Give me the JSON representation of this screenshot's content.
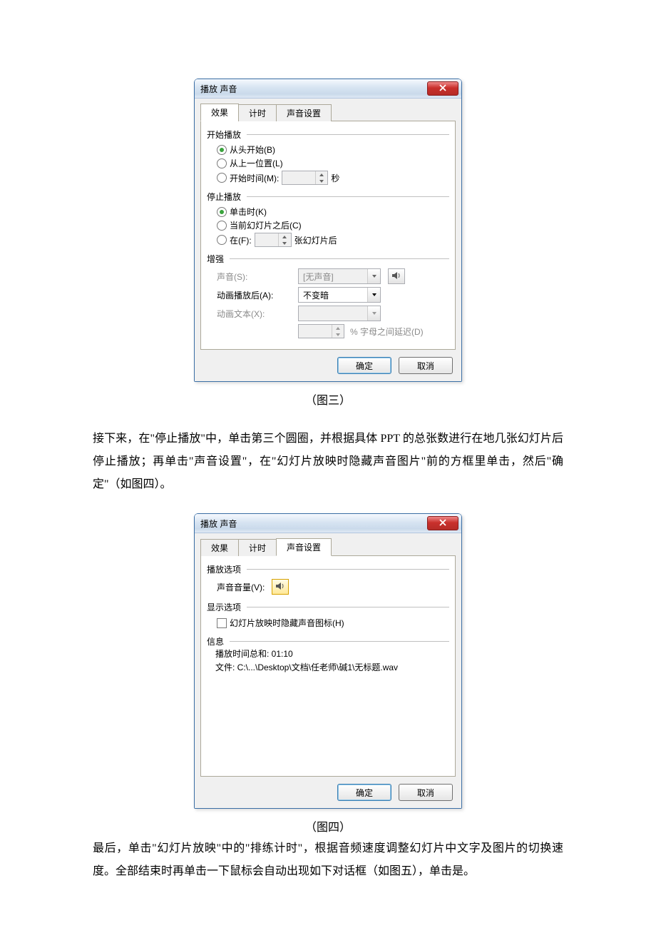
{
  "dialog1": {
    "title": "播放 声音",
    "tabs": {
      "effect": "效果",
      "timing": "计时",
      "sound": "声音设置"
    },
    "start": {
      "legend": "开始播放",
      "fromBegin": "从头开始(B)",
      "fromLast": "从上一位置(L)",
      "startTime": "开始时间(M):",
      "seconds": "秒"
    },
    "stop": {
      "legend": "停止播放",
      "onClick": "单击时(K)",
      "afterCurrent": "当前幻灯片之后(C)",
      "afterN_pre": "在(F):",
      "afterN_suf": "张幻灯片后"
    },
    "enhance": {
      "legend": "增强",
      "sound": "声音(S):",
      "soundVal": "[无声音]",
      "afterAnim": "动画播放后(A):",
      "afterAnimVal": "不变暗",
      "animText": "动画文本(X):",
      "delayText": "% 字母之间延迟(D)"
    },
    "buttons": {
      "ok": "确定",
      "cancel": "取消"
    }
  },
  "caption1": "（图三）",
  "para1": "接下来，在\"停止播放\"中，单击第三个圆圈，并根据具体 PPT 的总张数进行在地几张幻灯片后停止播放；再单击\"声音设置\"，在\"幻灯片放映时隐藏声音图片\"前的方框里单击，然后\"确定\"（如图四）。",
  "dialog2": {
    "title": "播放 声音",
    "tabs": {
      "effect": "效果",
      "timing": "计时",
      "sound": "声音设置"
    },
    "playOptions": {
      "legend": "播放选项",
      "volume": "声音音量(V):"
    },
    "displayOptions": {
      "legend": "显示选项",
      "hideIcon": "幻灯片放映时隐藏声音图标(H)"
    },
    "info": {
      "legend": "信息",
      "duration": "播放时间总和: 01:10",
      "filepath": "文件: C:\\...\\Desktop\\文档\\任老师\\碱1\\无标题.wav"
    },
    "buttons": {
      "ok": "确定",
      "cancel": "取消"
    }
  },
  "caption2": "（图四）",
  "para2": "最后，单击\"幻灯片放映\"中的\"排练计时\"，根据音频速度调整幻灯片中文字及图片的切换速度。全部结束时再单击一下鼠标会自动出现如下对话框（如图五），单击是。"
}
